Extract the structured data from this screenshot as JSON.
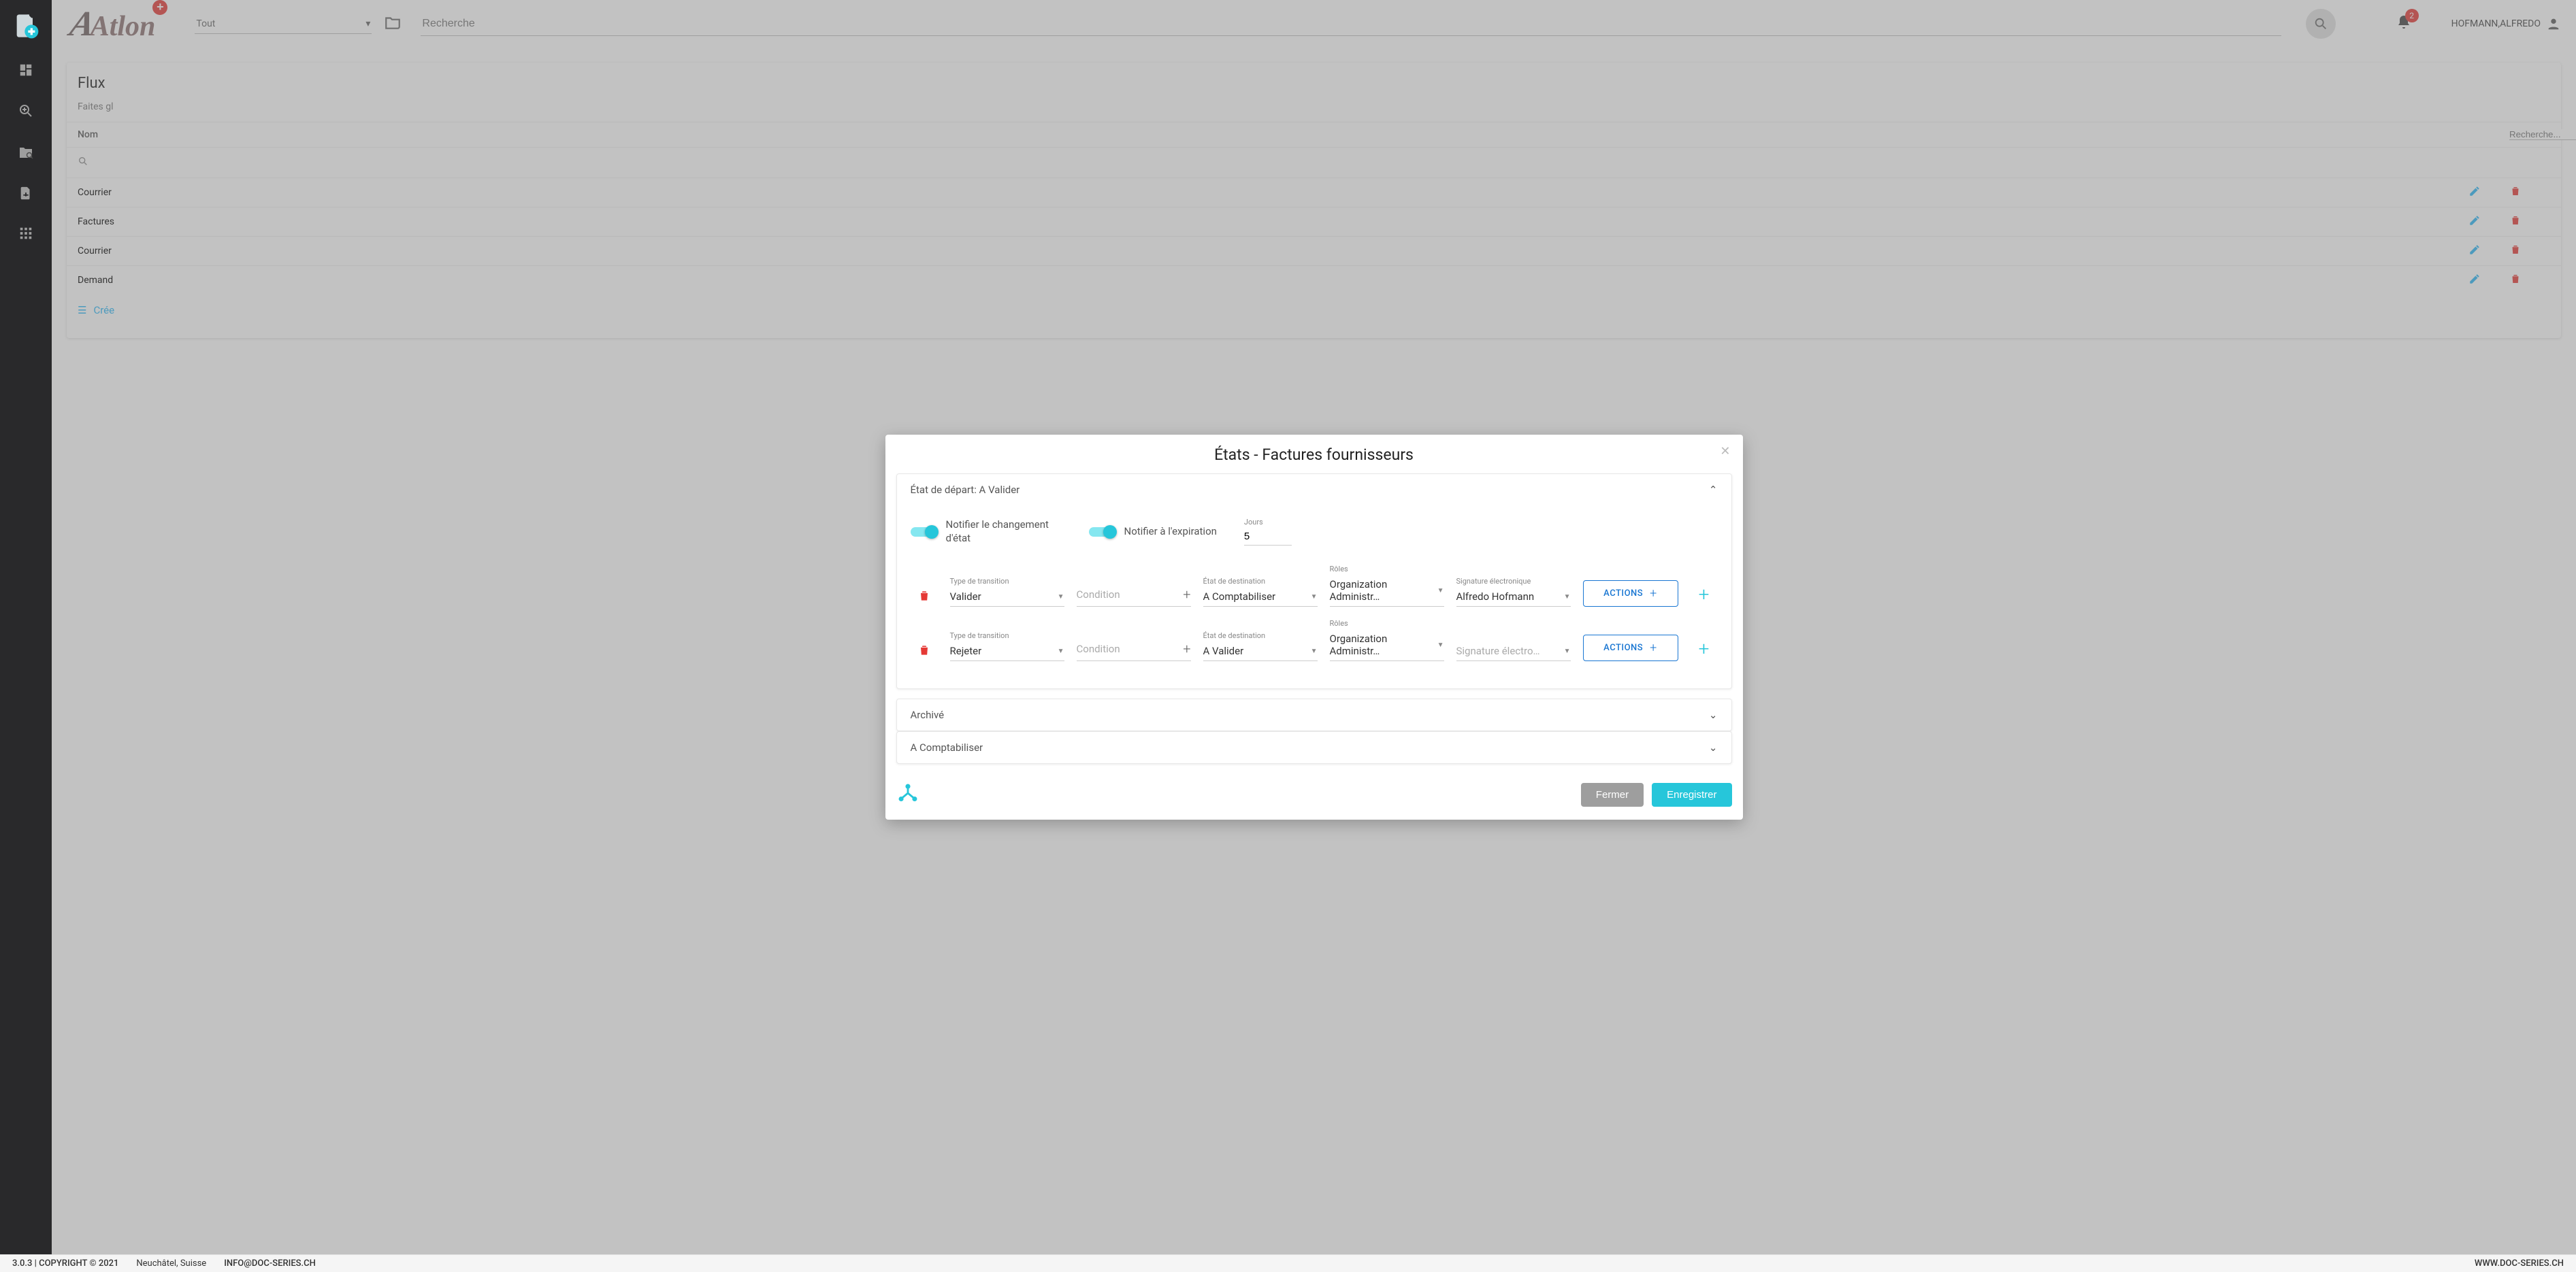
{
  "brand": {
    "name": "Atlon"
  },
  "top": {
    "scope": "Tout",
    "search_placeholder": "Recherche",
    "notif_count": "2",
    "user": "HOFMANN,ALFREDO"
  },
  "flux": {
    "title": "Flux",
    "hint_prefix": "Faites gl",
    "col_name": "Nom",
    "search_placeholder": "Recherche...",
    "rows": [
      "Courrier",
      "Factures",
      "Courrier",
      "Demand"
    ],
    "create_prefix": "Crée"
  },
  "modal": {
    "title": "États - Factures fournisseurs",
    "expanded_header": "État de départ: A Valider",
    "notify_state_label": "Notifier le changement d'état",
    "notify_exp_label": "Notifier à l'expiration",
    "jours_label": "Jours",
    "jours_value": "5",
    "labels": {
      "transition_type": "Type de transition",
      "condition_ph": "Condition",
      "dest_state": "État de destination",
      "roles": "Rôles",
      "signature": "Signature électronique",
      "actions": "ACTIONS"
    },
    "rows": [
      {
        "type": "Valider",
        "dest": "A Comptabiliser",
        "roles": "Organization Administr…",
        "sig": "Alfredo Hofmann",
        "sig_ph": false
      },
      {
        "type": "Rejeter",
        "dest": "A Valider",
        "roles": "Organization Administr…",
        "sig": "Signature électro…",
        "sig_ph": true
      }
    ],
    "collapsed": [
      "Archivé",
      "A Comptabiliser"
    ],
    "close_btn": "Fermer",
    "save_btn": "Enregistrer"
  },
  "footer": {
    "version": "3.0.3 | COPYRIGHT © 2021",
    "loc": "Neuchâtel, Suisse",
    "mail": "INFO@DOC-SERIES.CH",
    "site": "WWW.DOC-SERIES.CH"
  }
}
